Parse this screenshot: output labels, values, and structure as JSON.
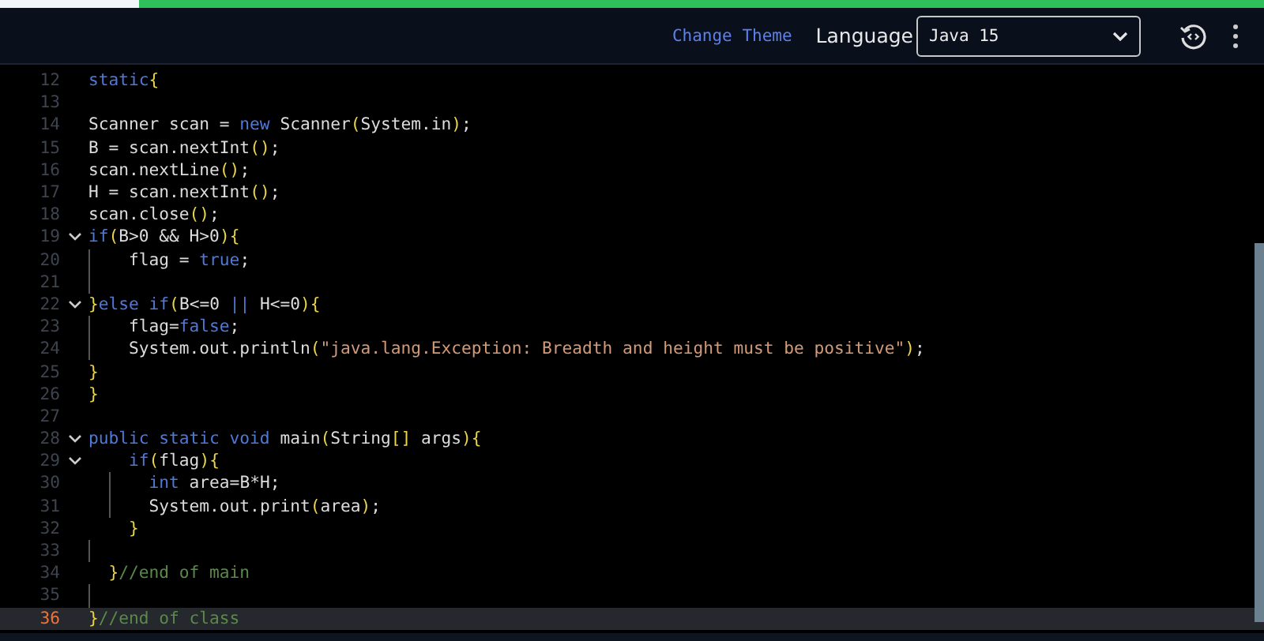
{
  "progress": {
    "level": 0.11
  },
  "toolbar": {
    "change_theme": "Change Theme",
    "language_label": "Language",
    "language_select": {
      "value": "Java 15"
    }
  },
  "editor": {
    "lines": [
      {
        "number": "12",
        "fold": false,
        "current": false,
        "guide": false,
        "tokens": [
          {
            "kind": "keyword",
            "text": "static"
          },
          {
            "kind": "bracket",
            "text": "{"
          }
        ]
      },
      {
        "number": "13",
        "fold": false,
        "current": false,
        "guide": false
      },
      {
        "number": "14",
        "fold": false,
        "current": false,
        "guide": false,
        "tokens": [
          {
            "kind": "plain",
            "text": "Scanner scan = "
          },
          {
            "kind": "keyword",
            "text": "new"
          },
          {
            "kind": "plain",
            "text": " Scanner"
          },
          {
            "kind": "bracket",
            "text": "("
          },
          {
            "kind": "plain",
            "text": "System.in"
          },
          {
            "kind": "bracket",
            "text": ")"
          },
          {
            "kind": "plain",
            "text": ";"
          }
        ]
      },
      {
        "number": "15",
        "fold": false,
        "current": false,
        "guide": false,
        "tokens": [
          {
            "kind": "plain",
            "text": "B = scan.nextInt"
          },
          {
            "kind": "bracket",
            "text": "()"
          },
          {
            "kind": "plain",
            "text": ";"
          }
        ]
      },
      {
        "number": "16",
        "fold": false,
        "current": false,
        "guide": false,
        "tokens": [
          {
            "kind": "plain",
            "text": "scan.nextLine"
          },
          {
            "kind": "bracket",
            "text": "()"
          },
          {
            "kind": "plain",
            "text": ";"
          }
        ]
      },
      {
        "number": "17",
        "fold": false,
        "current": false,
        "guide": false,
        "tokens": [
          {
            "kind": "plain",
            "text": "H = scan.nextInt"
          },
          {
            "kind": "bracket",
            "text": "()"
          },
          {
            "kind": "plain",
            "text": ";"
          }
        ]
      },
      {
        "number": "18",
        "fold": false,
        "current": false,
        "guide": false,
        "tokens": [
          {
            "kind": "plain",
            "text": "scan.close"
          },
          {
            "kind": "bracket",
            "text": "()"
          },
          {
            "kind": "plain",
            "text": ";"
          }
        ]
      },
      {
        "number": "19",
        "fold": true,
        "current": false,
        "guide": false,
        "tokens": [
          {
            "kind": "keyword",
            "text": "if"
          },
          {
            "kind": "bracket",
            "text": "("
          },
          {
            "kind": "plain",
            "text": "B>0 && H>0"
          },
          {
            "kind": "bracket",
            "text": "){"
          }
        ]
      },
      {
        "number": "20",
        "fold": false,
        "current": false,
        "guide": true,
        "kind": "single",
        "tokens": [
          {
            "kind": "plain",
            "text": "flag = "
          },
          {
            "kind": "keyword",
            "text": "true"
          },
          {
            "kind": "plain",
            "text": ";"
          }
        ]
      },
      {
        "number": "21",
        "fold": false,
        "current": false,
        "guide": true
      },
      {
        "number": "22",
        "fold": true,
        "current": false,
        "guide": false,
        "tokens": [
          {
            "kind": "bracket",
            "text": "}"
          },
          {
            "kind": "keyword",
            "text": "else if"
          },
          {
            "kind": "bracket",
            "text": "("
          },
          {
            "kind": "plain",
            "text": "B<=0 "
          },
          {
            "kind": "keyword",
            "text": "||"
          },
          {
            "kind": "plain",
            "text": " H<=0"
          },
          {
            "kind": "bracket",
            "text": "){"
          }
        ]
      },
      {
        "number": "23",
        "fold": false,
        "current": false,
        "guide": true,
        "kind": "single",
        "tokens": [
          {
            "kind": "plain",
            "text": "flag="
          },
          {
            "kind": "keyword",
            "text": "false"
          },
          {
            "kind": "plain",
            "text": ";"
          }
        ]
      },
      {
        "number": "24",
        "fold": false,
        "current": false,
        "guide": true,
        "kind": "single",
        "tokens": [
          {
            "kind": "plain",
            "text": "System.out.println"
          },
          {
            "kind": "bracket",
            "text": "("
          },
          {
            "kind": "string",
            "text": "\"java.lang.Exception: Breadth and height must be positive\""
          },
          {
            "kind": "bracket",
            "text": ")"
          },
          {
            "kind": "plain",
            "text": ";"
          }
        ]
      },
      {
        "number": "25",
        "fold": false,
        "current": false,
        "guide": false,
        "tokens": [
          {
            "kind": "bracket",
            "text": "}"
          }
        ]
      },
      {
        "number": "26",
        "fold": false,
        "current": false,
        "guide": false,
        "tokens": [
          {
            "kind": "bracket",
            "text": "}"
          }
        ]
      },
      {
        "number": "27",
        "fold": false,
        "current": false,
        "guide": false
      },
      {
        "number": "28",
        "fold": true,
        "current": false,
        "guide": false,
        "tokens": [
          {
            "kind": "keyword",
            "text": "public static void"
          },
          {
            "kind": "plain",
            "text": " main"
          },
          {
            "kind": "bracket",
            "text": "("
          },
          {
            "kind": "plain",
            "text": "String"
          },
          {
            "kind": "bracket",
            "text": "[]"
          },
          {
            "kind": "plain",
            "text": " args"
          },
          {
            "kind": "bracket",
            "text": "){"
          }
        ]
      },
      {
        "number": "29",
        "fold": true,
        "current": false,
        "guide": false,
        "kind": "single",
        "tokens": [
          {
            "kind": "keyword",
            "text": "if"
          },
          {
            "kind": "bracket",
            "text": "("
          },
          {
            "kind": "plain",
            "text": "flag"
          },
          {
            "kind": "bracket",
            "text": "){"
          }
        ]
      },
      {
        "number": "30",
        "fold": false,
        "current": false,
        "guide": true,
        "kind": "deep",
        "tokens": [
          {
            "kind": "keyword",
            "text": "int"
          },
          {
            "kind": "plain",
            "text": " area=B*H;"
          }
        ]
      },
      {
        "number": "31",
        "fold": false,
        "current": false,
        "guide": true,
        "kind": "deep",
        "tokens": [
          {
            "kind": "plain",
            "text": "System.out.print"
          },
          {
            "kind": "bracket",
            "text": "("
          },
          {
            "kind": "plain",
            "text": "area"
          },
          {
            "kind": "bracket",
            "text": ")"
          },
          {
            "kind": "plain",
            "text": ";"
          }
        ]
      },
      {
        "number": "32",
        "fold": false,
        "current": false,
        "guide": false,
        "kind": "single",
        "tokens": [
          {
            "kind": "bracket",
            "text": "}"
          }
        ]
      },
      {
        "number": "33",
        "fold": false,
        "current": false,
        "guide": true
      },
      {
        "number": "34",
        "fold": false,
        "current": false,
        "guide": false,
        "kind": "half",
        "tokens": [
          {
            "kind": "bracket",
            "text": "}"
          },
          {
            "kind": "comment",
            "text": "//end of main"
          }
        ]
      },
      {
        "number": "35",
        "fold": false,
        "current": false,
        "guide": true
      },
      {
        "number": "36",
        "fold": false,
        "current": true,
        "guide": false,
        "tokens": [
          {
            "kind": "bracket",
            "text": "}"
          },
          {
            "kind": "comment",
            "text": "//end of class"
          }
        ]
      }
    ]
  }
}
